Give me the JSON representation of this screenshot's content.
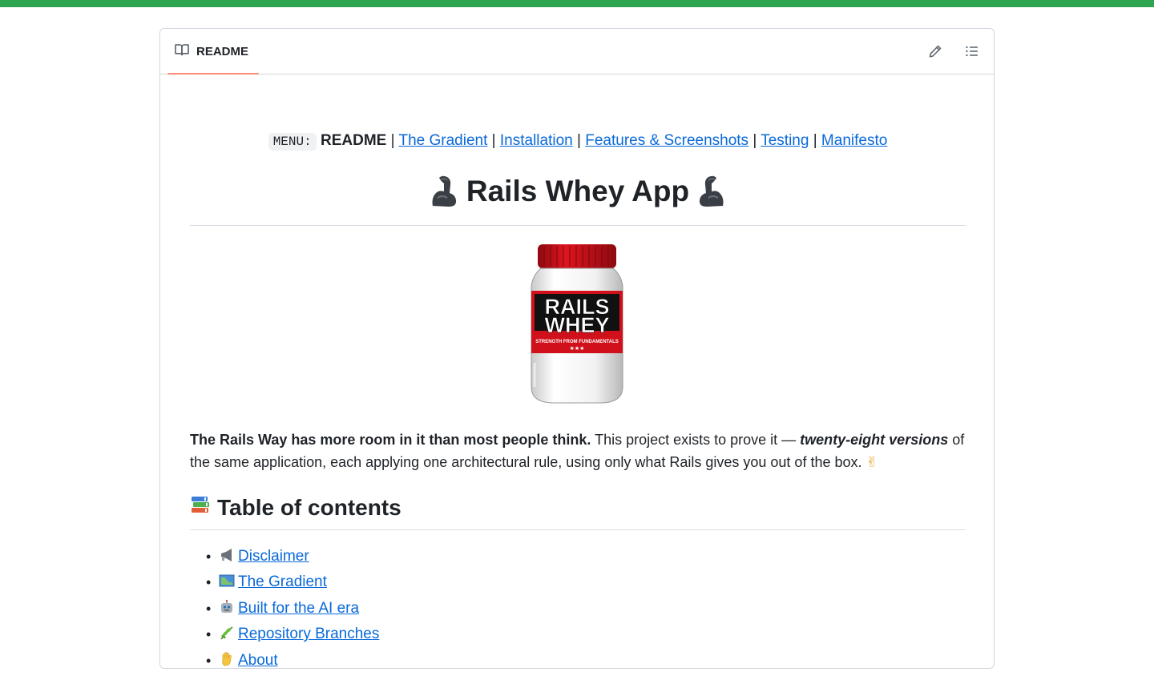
{
  "readme": {
    "tab_label": "README",
    "edit_icon": "pencil-icon",
    "outline_icon": "list-unordered-icon"
  },
  "menu": {
    "code_label": "MENU:",
    "current": "README",
    "separator": "|",
    "links": [
      "The Gradient",
      "Installation",
      "Features & Screenshots",
      "Testing",
      "Manifesto"
    ]
  },
  "title": "Rails Whey App",
  "title_emoji": "flexed-biceps-emoji",
  "jar": {
    "line1": "RAILS",
    "line2": "WHEY",
    "tagline": "STRENGTH FROM FUNDAMENTALS",
    "stars": "★★★"
  },
  "intro": {
    "bold": "The Rails Way has more room in it than most people think.",
    "text1": " This project exists to prove it — ",
    "italic": "twenty-eight versions",
    "text2": " of the same application, each applying one architectural rule, using only what Rails gives you out of the box. ",
    "emoji": "✌"
  },
  "toc": {
    "heading": "Table of contents",
    "heading_emoji": "books-emoji",
    "items": [
      {
        "label": "Disclaimer",
        "emoji": "loudspeaker-emoji"
      },
      {
        "label": "The Gradient",
        "emoji": "map-emoji"
      },
      {
        "label": "Built for the AI era",
        "emoji": "robot-emoji"
      },
      {
        "label": "Repository Branches",
        "emoji": "herb-emoji"
      },
      {
        "label": "About",
        "emoji": "waving-hand-emoji"
      }
    ]
  },
  "colors": {
    "top_bar": "#2da44e",
    "link": "#0969da",
    "tab_underline": "#fd8c73",
    "jar_red": "#d0111b"
  }
}
